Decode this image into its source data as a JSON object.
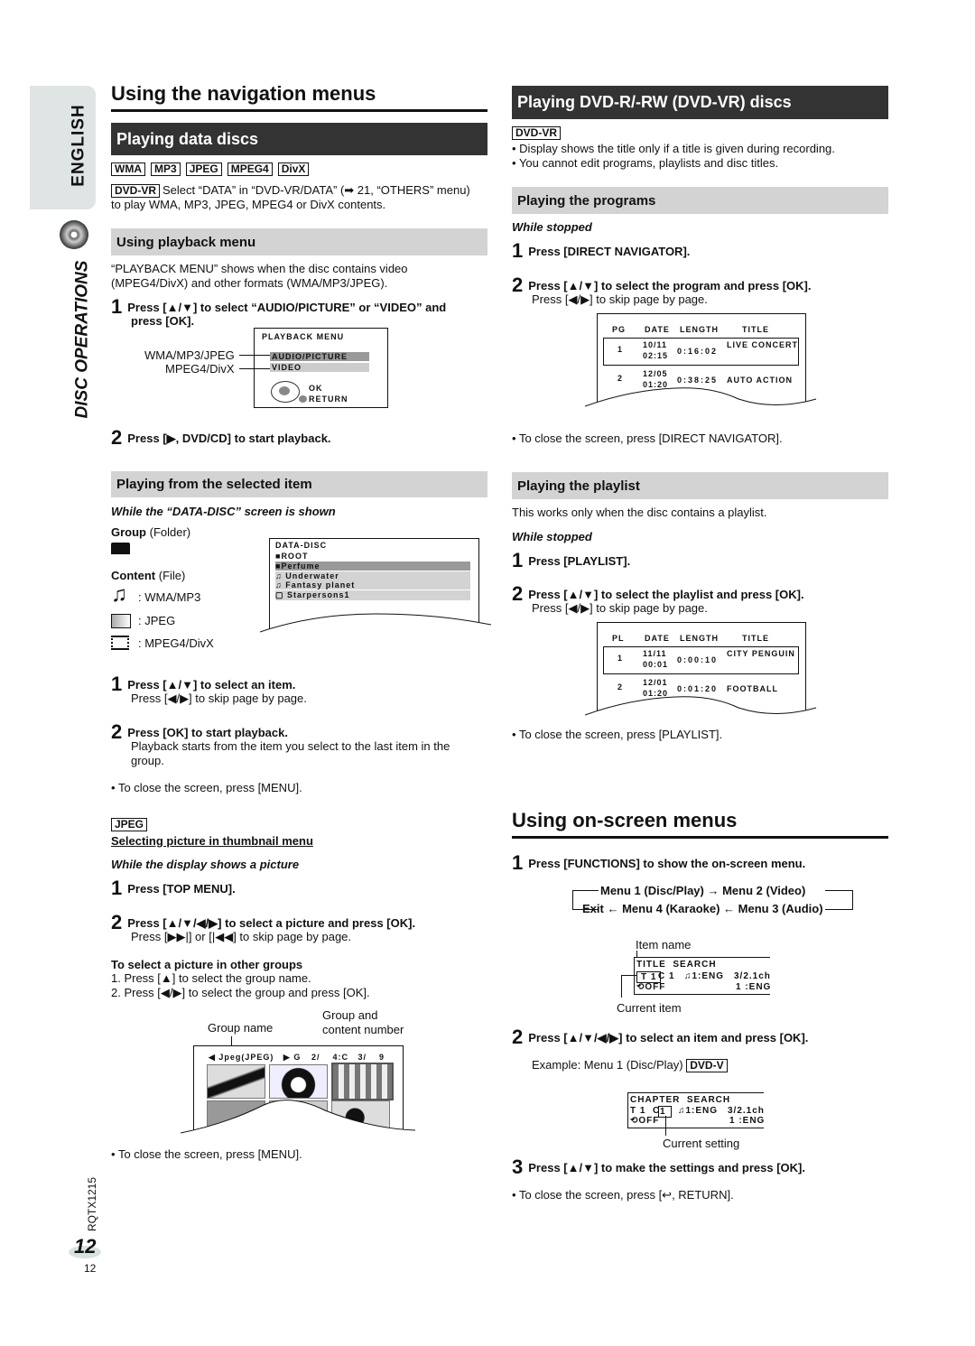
{
  "side": {
    "language": "ENGLISH",
    "section": "DISC OPERATIONS",
    "model": "RQTX1215",
    "page_big": "12",
    "page_small": "12"
  },
  "left": {
    "title": "Using the navigation menus",
    "data_discs": {
      "heading": "Playing data discs",
      "tags": [
        "WMA",
        "MP3",
        "JPEG",
        "MPEG4",
        "DivX"
      ],
      "dvdvr_tag": "DVD-VR",
      "dvdvr_line1": "Select “DATA” in “DVD-VR/DATA” (➡ 21, “OTHERS” menu)",
      "dvdvr_line2": "to play WMA, MP3, JPEG, MPEG4 or DivX contents."
    },
    "playback_menu": {
      "heading": "Using playback menu",
      "para1": "“PLAYBACK MENU” shows when the disc contains video",
      "para2": "(MPEG4/DivX) and other formats (WMA/MP3/JPEG).",
      "step1_line1": "Press [▲/▼] to select “AUDIO/PICTURE” or “VIDEO” and",
      "step1_line2": "press [OK].",
      "screen_title": "PLAYBACK MENU",
      "opt1": "AUDIO/PICTURE",
      "opt2": "VIDEO",
      "ok": "OK",
      "return": "RETURN",
      "label1": "WMA/MP3/JPEG",
      "label2": "MPEG4/DivX",
      "step2": "Press [▶, DVD/CD] to start playback."
    },
    "selected_item": {
      "heading": "Playing from the selected item",
      "condition": "While the “DATA-DISC” screen is shown",
      "group_label": "Group",
      "group_note": "(Folder)",
      "content_label": "Content",
      "content_note": "(File)",
      "legend": [
        ": WMA/MP3",
        ": JPEG",
        ": MPEG4/DivX"
      ],
      "screen_title": "DATA-DISC",
      "items": [
        "ROOT",
        "Perfume",
        "Underwater",
        "Fantasy planet",
        "Starpersons1"
      ],
      "step1": "Press [▲/▼] to select an item.",
      "step1_sub": "Press [◀/▶] to skip page by page.",
      "step2": "Press [OK] to start playback.",
      "step2_sub1": "Playback starts from the item you select to the last item in the",
      "step2_sub2": "group.",
      "close": "To close the screen, press [MENU]."
    },
    "thumbnail": {
      "tag": "JPEG",
      "heading": "Selecting picture in thumbnail menu",
      "condition": "While the display shows a picture",
      "step1": "Press [TOP MENU].",
      "step2": "Press [▲/▼/◀/▶] to select a picture and press [OK].",
      "step2_sub": "Press [▶▶|] or [|◀◀] to skip page by page.",
      "other_heading": "To select a picture in other groups",
      "other1": "1. Press [▲] to select the group name.",
      "other2": "2. Press [◀/▶] to select the group and press [OK].",
      "label_group_name": "Group name",
      "label_group_content1": "Group and",
      "label_group_content2": "content number",
      "bar_group": "◀ Jpeg(JPEG)   ▶ G",
      "bar_nums": "2/    4:C   3/    9",
      "close": "To close the screen, press [MENU]."
    }
  },
  "right": {
    "dvdvr": {
      "heading": "Playing DVD-R/-RW (DVD-VR) discs",
      "tag": "DVD-VR",
      "bullets": [
        "Display shows the title only if a title is given during recording.",
        "You cannot edit programs, playlists and disc titles."
      ]
    },
    "programs": {
      "heading": "Playing the programs",
      "condition": "While stopped",
      "step1": "Press [DIRECT NAVIGATOR].",
      "step2": "Press [▲/▼] to select the program and press [OK].",
      "step2_sub": "Press [◀/▶] to skip page by page.",
      "columns": [
        "PG",
        "DATE",
        "LENGTH",
        "TITLE"
      ],
      "rows": [
        {
          "n": "1",
          "date": "10/11",
          "time": "02:15",
          "length": "0:16:02",
          "title": "LIVE CONCERT"
        },
        {
          "n": "2",
          "date": "12/05",
          "time": "01:20",
          "length": "0:38:25",
          "title": "AUTO ACTION"
        }
      ],
      "close": "To close the screen, press [DIRECT NAVIGATOR]."
    },
    "playlist": {
      "heading": "Playing the playlist",
      "note": "This works only when the disc contains a playlist.",
      "condition": "While stopped",
      "step1": "Press [PLAYLIST].",
      "step2": "Press [▲/▼] to select the playlist and press [OK].",
      "step2_sub": "Press [◀/▶] to skip page by page.",
      "columns": [
        "PL",
        "DATE",
        "LENGTH",
        "TITLE"
      ],
      "rows": [
        {
          "n": "1",
          "date": "11/11",
          "time": "00:01",
          "length": "0:00:10",
          "title": "CITY PENGUIN"
        },
        {
          "n": "2",
          "date": "12/01",
          "time": "01:20",
          "length": "0:01:20",
          "title": "FOOTBALL"
        }
      ],
      "close": "To close the screen, press [PLAYLIST]."
    },
    "onscreen": {
      "title": "Using on-screen menus",
      "step1": "Press [FUNCTIONS] to show the on-screen menu.",
      "flow1": "Menu 1 (Disc/Play) → Menu 2 (Video)",
      "flow2": "Exit ← Menu 4 (Karaoke) ← Menu 3 (Audio)",
      "item_name": "Item name",
      "d1_title": "TITLE  SEARCH",
      "d1_cur": "T 1",
      "d1_c": "C 1",
      "d1_audio": "♫1:ENG",
      "d1_ch": "3/2.1ch",
      "d1_off": "OFF",
      "d1_sub": "1 :ENG",
      "current_item": "Current item",
      "step2": "Press [▲/▼/◀/▶] to select an item and press [OK].",
      "example": "Example: Menu 1 (Disc/Play)",
      "example_tag": "DVD-V",
      "d2_title": "CHAPTER  SEARCH",
      "d2_t": "T 1  C",
      "d2_cur": "1",
      "d2_audio": "♫1:ENG",
      "d2_ch": "3/2.1ch",
      "d2_off": "OFF",
      "d2_sub": "1 :ENG",
      "current_setting": "Current setting",
      "step3": "Press [▲/▼] to make the settings and press [OK].",
      "close": "To close the screen, press [↩, RETURN]."
    }
  }
}
